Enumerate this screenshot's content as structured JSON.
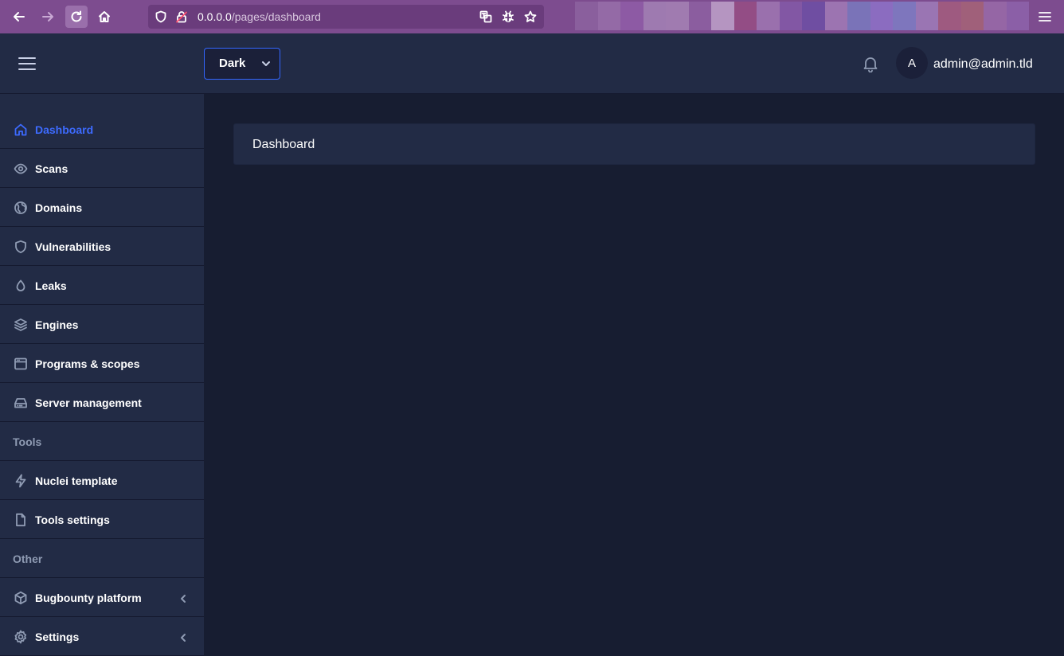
{
  "browser": {
    "url_host": "0.0.0.0",
    "url_path": "/pages/dashboard",
    "tab_colors": [
      "#8a5f9d",
      "#946aa6",
      "#8d5aa4",
      "#9e7ab0",
      "#a07bb0",
      "#8b5d9f",
      "#b595c1",
      "#934d85",
      "#9a70ad",
      "#8257a4",
      "#6f4ea2",
      "#9c74b1",
      "#7a73b8",
      "#8b6cc0",
      "#7e76bd",
      "#9a75b3",
      "#9e5a80",
      "#a0607a",
      "#9566a5",
      "#8b5fa7"
    ]
  },
  "header": {
    "theme_value": "Dark",
    "avatar_initial": "A",
    "user_email": "admin@admin.tld"
  },
  "sidebar": {
    "items": [
      {
        "label": "Dashboard",
        "icon": "home-icon",
        "active": true
      },
      {
        "label": "Scans",
        "icon": "eye-icon"
      },
      {
        "label": "Domains",
        "icon": "globe-icon"
      },
      {
        "label": "Vulnerabilities",
        "icon": "shield-icon"
      },
      {
        "label": "Leaks",
        "icon": "droplet-icon"
      },
      {
        "label": "Engines",
        "icon": "layers-icon"
      },
      {
        "label": "Programs & scopes",
        "icon": "browser-icon"
      },
      {
        "label": "Server management",
        "icon": "hard-drive-icon"
      }
    ],
    "tools_group": "Tools",
    "tools_items": [
      {
        "label": "Nuclei template",
        "icon": "flash-icon"
      },
      {
        "label": "Tools settings",
        "icon": "file-icon"
      }
    ],
    "other_group": "Other",
    "other_items": [
      {
        "label": "Bugbounty platform",
        "icon": "cube-icon"
      },
      {
        "label": "Settings",
        "icon": "settings-icon"
      }
    ]
  },
  "main": {
    "card_title": "Dashboard"
  },
  "colors": {
    "accent": "#3366ff",
    "sidebar_bg": "#222b45",
    "main_bg": "#171d31",
    "browser_bar": "#7d4c8f"
  }
}
